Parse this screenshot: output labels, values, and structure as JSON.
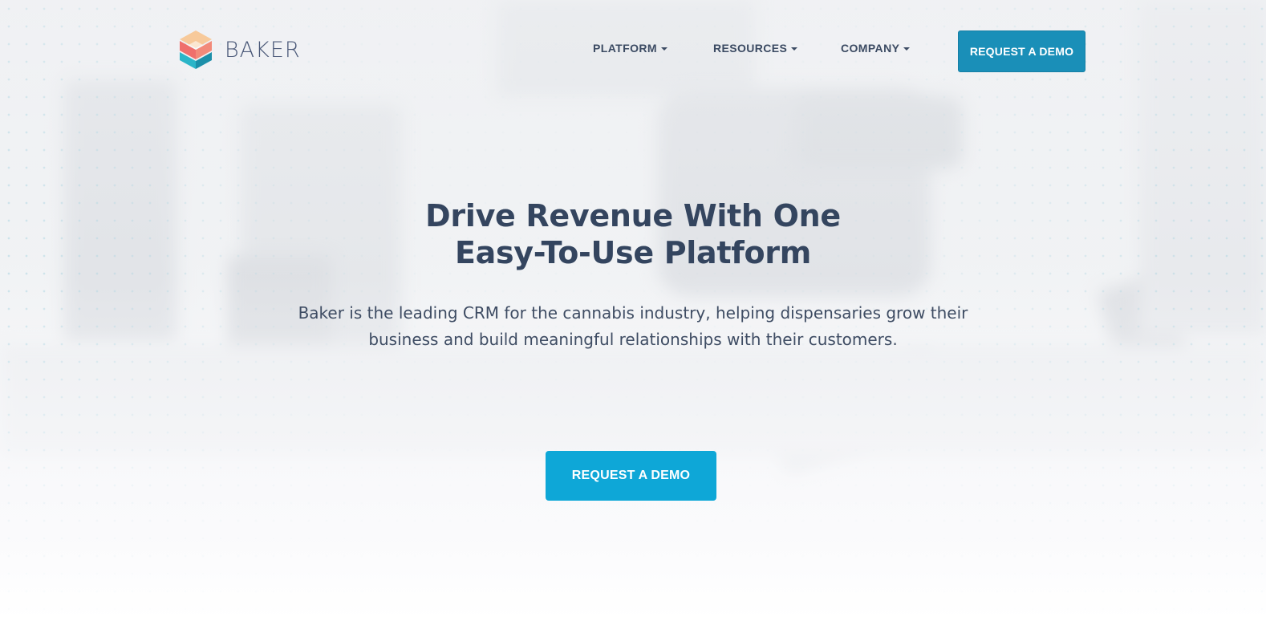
{
  "brand": {
    "name": "BAKER",
    "logo_icon": "baker-hexagon-logo-icon",
    "colors": {
      "peach": "#f7c99a",
      "coral": "#ef6f6c",
      "teal": "#2bb5c8",
      "dark_teal": "#1c8fa9"
    }
  },
  "nav": {
    "items": [
      {
        "label": "PLATFORM",
        "icon": "caret-down-icon"
      },
      {
        "label": "RESOURCES",
        "icon": "caret-down-icon"
      },
      {
        "label": "COMPANY",
        "icon": "caret-down-icon"
      }
    ],
    "cta_label": "REQUEST A DEMO",
    "cta_color": "#1a8fb8"
  },
  "hero": {
    "title_line1": "Drive Revenue With One",
    "title_line2": "Easy-To-Use Platform",
    "subtitle_line1": "Baker is the leading CRM for the cannabis industry, helping dispensaries grow their",
    "subtitle_line2": "business and build meaningful relationships with their customers.",
    "cta_label": "REQUEST A DEMO",
    "cta_color": "#0ea7d7",
    "text_color": "#34455f"
  }
}
